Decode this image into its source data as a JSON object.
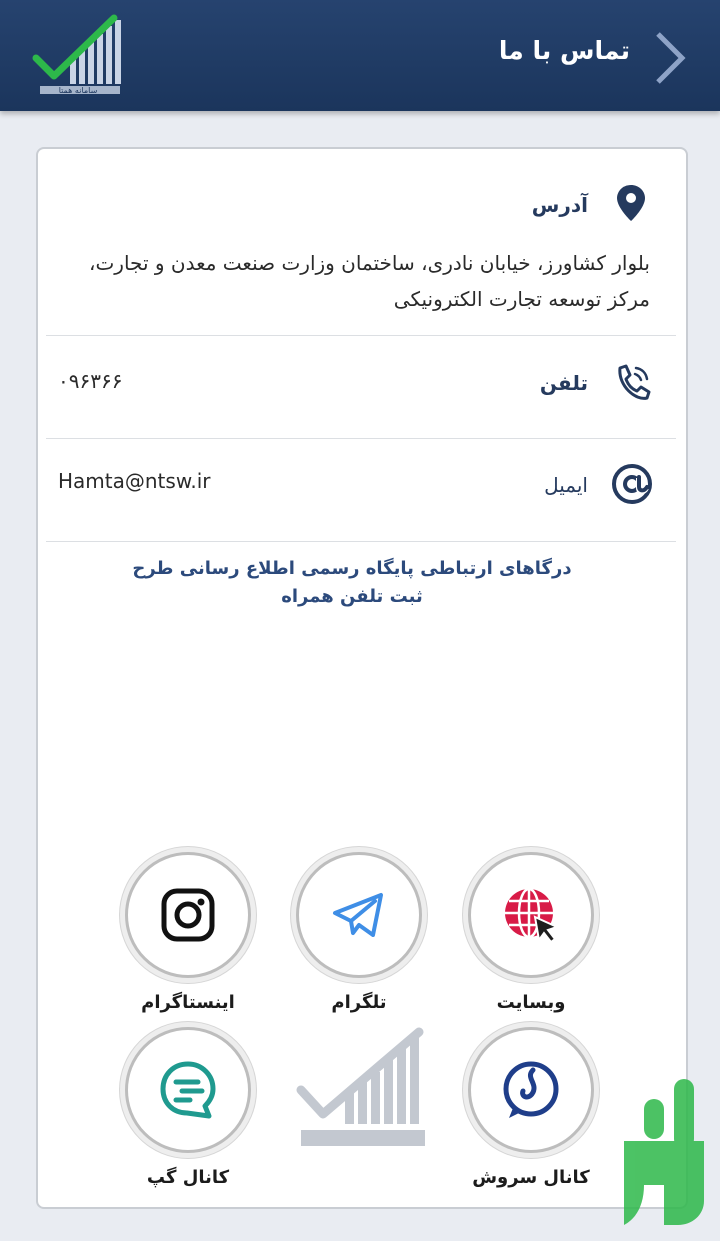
{
  "header": {
    "title": "تماس با ما",
    "back_icon": "chevron-right-icon",
    "logo_text": "سامانه همتا"
  },
  "contact": {
    "address": {
      "label": "آدرس",
      "icon": "location-pin-icon",
      "text": "بلوار کشاورز، خیابان نادری، ساختمان وزارت صنعت معدن و تجارت، مرکز توسعه تجارت الکترونیکی"
    },
    "phone": {
      "label": "تلفن",
      "icon": "phone-call-icon",
      "value": "۰۹۶۳۶۶"
    },
    "email": {
      "label": "ایمیل",
      "icon": "at-sign-icon",
      "value": "Hamta@ntsw.ir"
    }
  },
  "portals": {
    "title": "درگاهای ارتباطی پایگاه رسمی اطلاع رسانی طرح ثبت تلفن همراه",
    "items": [
      {
        "label": "وبسایت",
        "icon": "globe-icon",
        "color": "#d81b47"
      },
      {
        "label": "تلگرام",
        "icon": "telegram-icon",
        "color": "#3f8ee6"
      },
      {
        "label": "اینستاگرام",
        "icon": "instagram-icon",
        "color": "#111111"
      },
      {
        "label": "کانال سروش",
        "icon": "soroush-icon",
        "color": "#1f3e8a"
      },
      {
        "label": "کانال گپ",
        "icon": "gap-icon",
        "color": "#1f9a8f"
      }
    ]
  },
  "colors": {
    "header_bg": "#1f3b64",
    "accent": "#253a5e",
    "logo_green": "#2db84a",
    "badge_green": "#2db84a"
  }
}
